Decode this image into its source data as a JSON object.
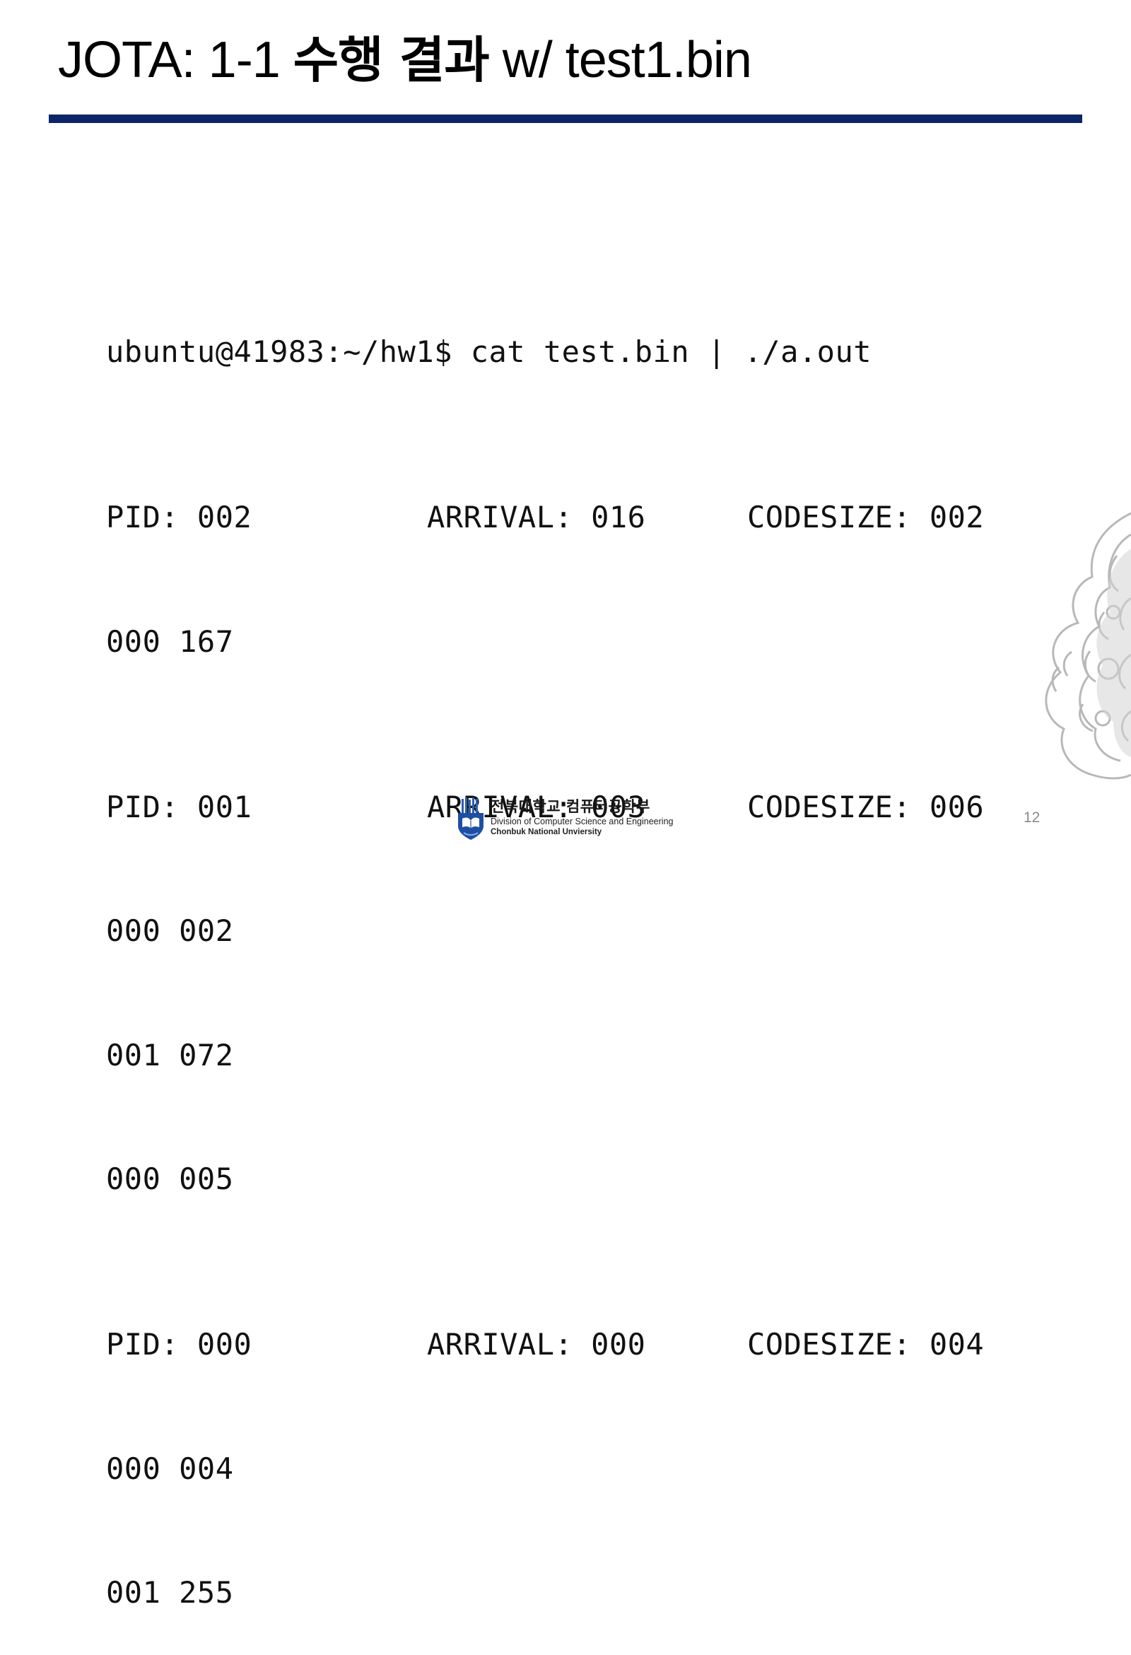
{
  "slide": {
    "title_prefix": "JOTA: 1-1 ",
    "title_korean": "수행 결과",
    "title_suffix": " w/ test1.bin",
    "rule_color": "#0b2566"
  },
  "terminal": {
    "command": "ubuntu@41983:~/hw1$ cat test.bin | ./a.out",
    "processes": [
      {
        "pid": "PID: 002",
        "arrival": "ARRIVAL: 016",
        "codesize": "CODESIZE: 002",
        "code": [
          "000 167"
        ]
      },
      {
        "pid": "PID: 001",
        "arrival": "ARRIVAL: 003",
        "codesize": "CODESIZE: 006",
        "code": [
          "000 002",
          "001 072",
          "000 005"
        ]
      },
      {
        "pid": "PID: 000",
        "arrival": "ARRIVAL: 000",
        "codesize": "CODESIZE: 004",
        "code": [
          "000 004",
          "001 255"
        ]
      }
    ]
  },
  "footer": {
    "korean_name": "전북대학교 컴퓨터공학부",
    "english_division": "Division of Computer Science and Engineering",
    "english_university": "Chonbuk National Unviersity",
    "emblem_icon": "university-emblem-icon",
    "watermark_icon": "university-seal-watermark-icon"
  },
  "page_number": "12"
}
